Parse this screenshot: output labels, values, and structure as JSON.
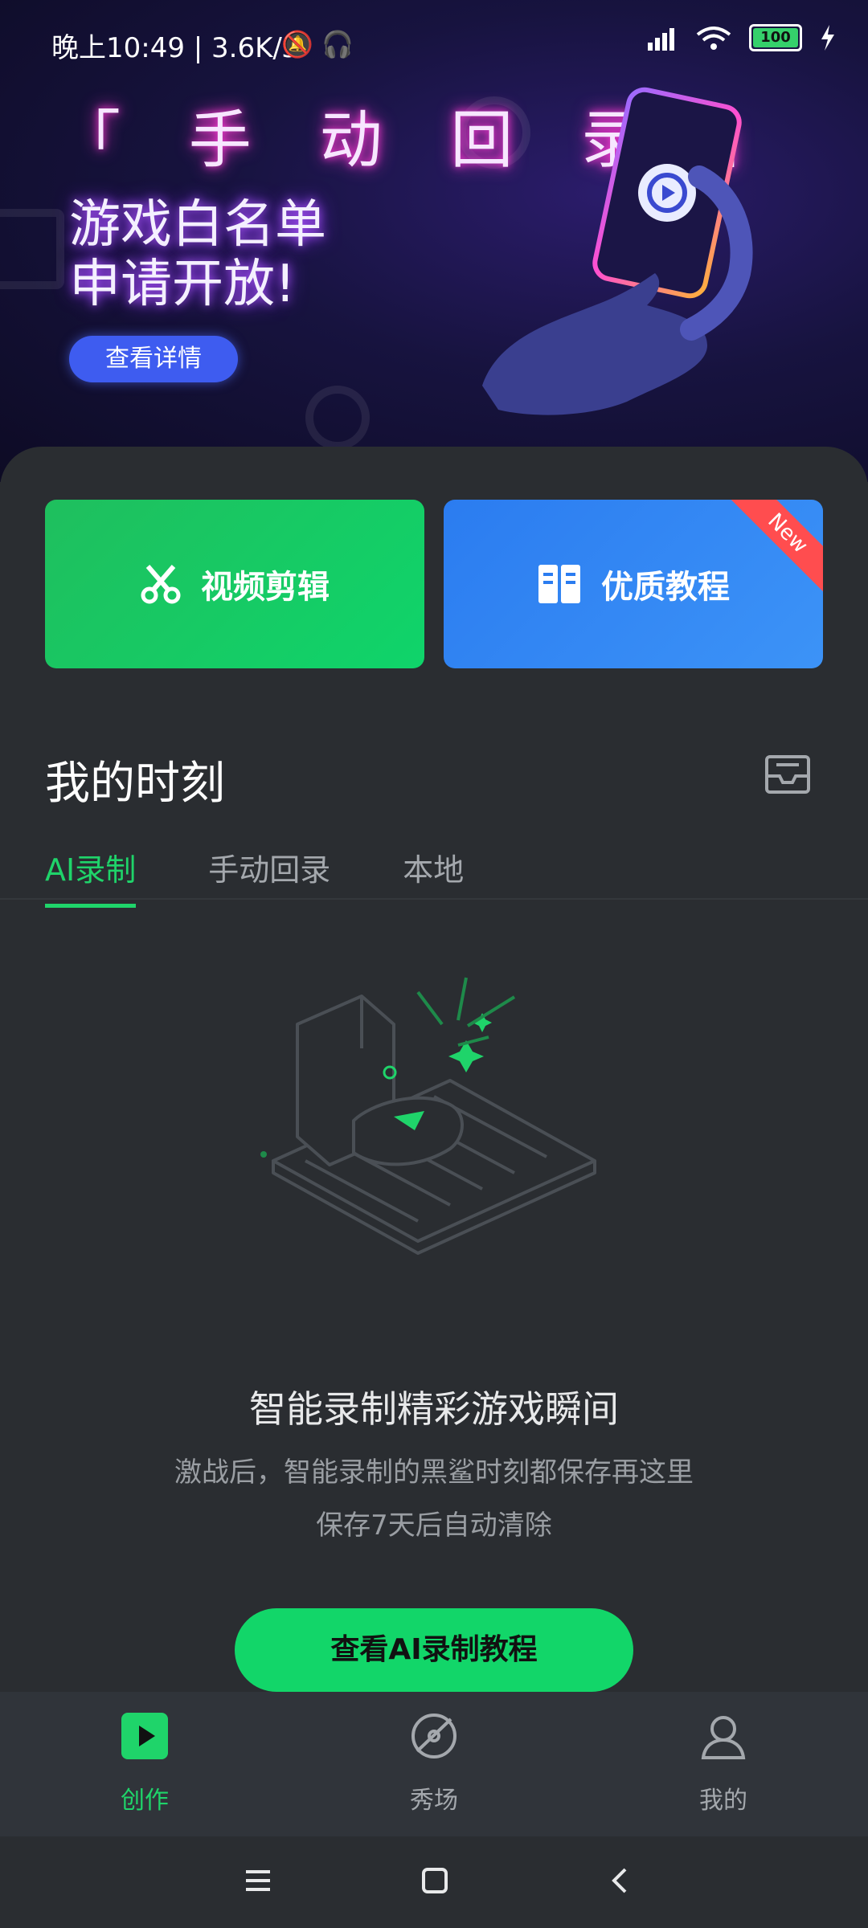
{
  "status_bar": {
    "time_text": "晚上10:49 | 3.6K/s",
    "battery": "100"
  },
  "banner": {
    "title": "「 手 动 回 录 」",
    "line1": "游戏白名单",
    "line2": "申请开放!",
    "button": "查看详情"
  },
  "quick_cards": [
    {
      "label": "视频剪辑",
      "icon": "scissors-icon"
    },
    {
      "label": "优质教程",
      "icon": "book-icon",
      "badge": "New"
    }
  ],
  "section": {
    "title": "我的时刻"
  },
  "tabs": [
    {
      "label": "AI录制",
      "active": true
    },
    {
      "label": "手动回录",
      "active": false
    },
    {
      "label": "本地",
      "active": false
    }
  ],
  "empty_state": {
    "title": "智能录制精彩游戏瞬间",
    "desc_line1": "激战后，智能录制的黑鲨时刻都保存再这里",
    "desc_line2": "保存7天后自动清除",
    "button": "查看AI录制教程"
  },
  "bottom_nav": [
    {
      "label": "创作",
      "icon": "play-square-icon",
      "active": true
    },
    {
      "label": "秀场",
      "icon": "planet-icon",
      "active": false
    },
    {
      "label": "我的",
      "icon": "person-icon",
      "active": false
    }
  ],
  "colors": {
    "accent": "#1fd46a",
    "background": "#2a2d31",
    "card_green": "#1fbf5e",
    "card_blue": "#2b7cf0"
  }
}
